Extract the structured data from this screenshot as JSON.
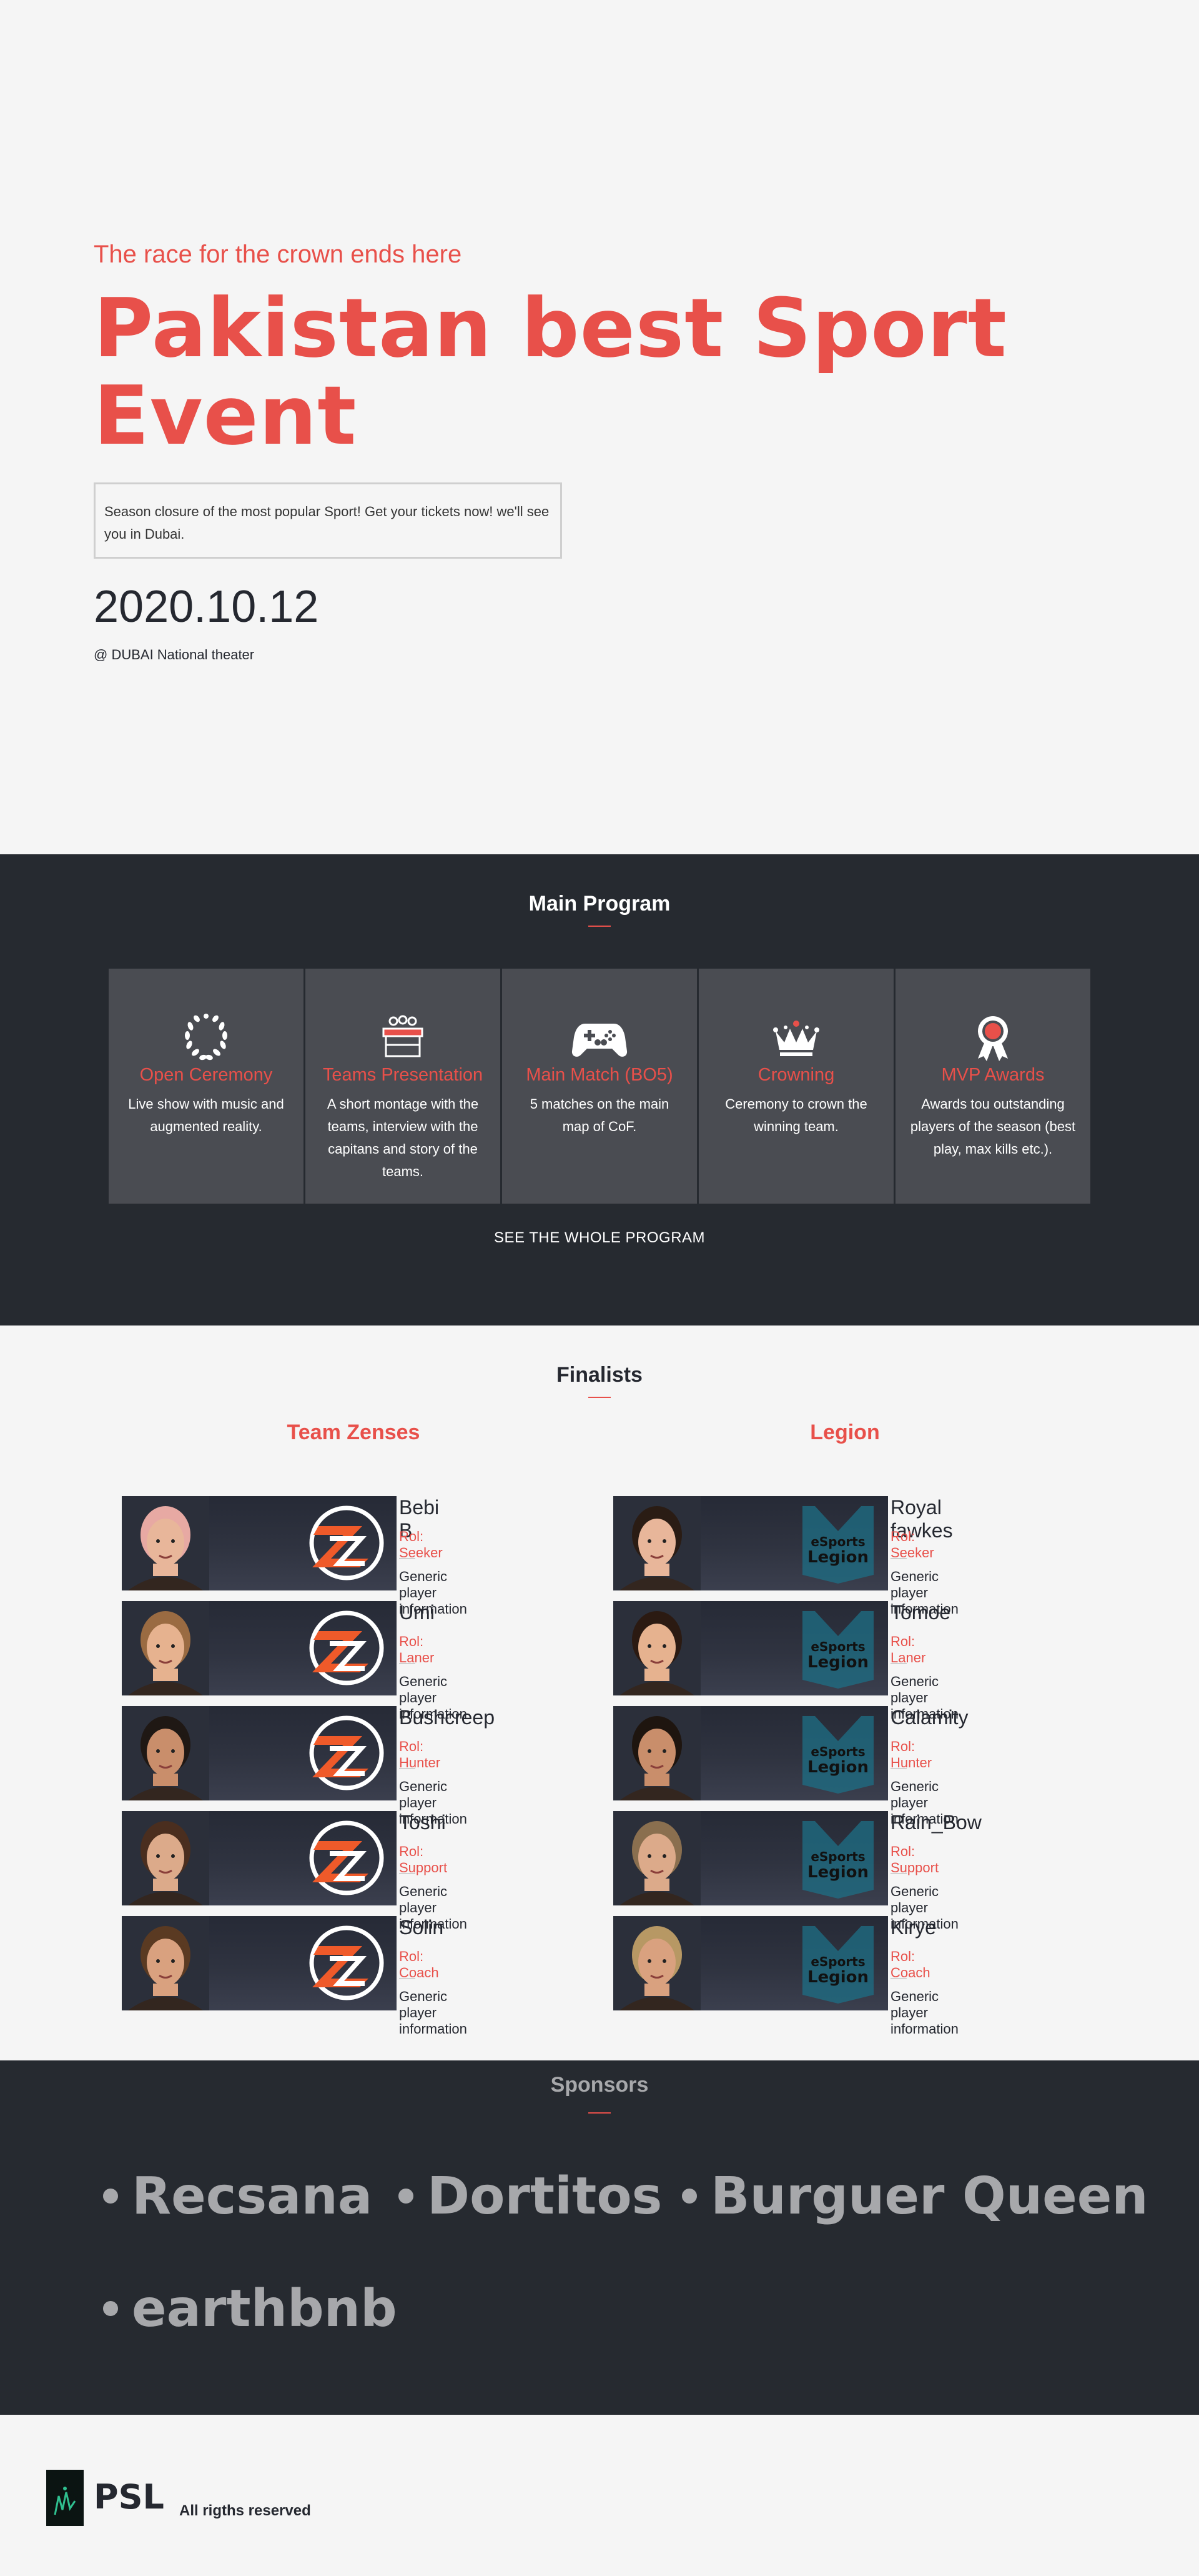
{
  "hero": {
    "tagline": "The race for the crown ends here",
    "title": "Pakistan best Sport Event",
    "description": "Season closure of the most popular Sport! Get your tickets now! we'll see you in Dubai.",
    "date": "2020.10.12",
    "venue": "@ DUBAI National theater"
  },
  "program": {
    "title": "Main Program",
    "cards": [
      {
        "icon": "laurel-wreath-icon",
        "title": "Open Ceremony",
        "desc": "Live show with music and augmented reality."
      },
      {
        "icon": "presentation-table-icon",
        "title": "Teams Presentation",
        "desc": "A short montage with the teams, interview with the capitans and story of the teams."
      },
      {
        "icon": "gamepad-icon",
        "title": "Main Match (BO5)",
        "desc": "5 matches on the main map of CoF."
      },
      {
        "icon": "crown-icon",
        "title": "Crowning",
        "desc": "Ceremony to crown the winning team."
      },
      {
        "icon": "award-ribbon-icon",
        "title": "MVP Awards",
        "desc": "Awards tou outstanding players of the season (best play, max kills etc.)."
      }
    ],
    "see_all": "SEE THE WHOLE PROGRAM"
  },
  "finalists": {
    "title": "Finalists",
    "teams": [
      {
        "name": "Team Zenses",
        "players": [
          {
            "name": "Bebi B",
            "role": "Rol: Seeker",
            "info": "Generic player information"
          },
          {
            "name": "Umi",
            "role": "Rol: Laner",
            "info": "Generic player information"
          },
          {
            "name": "Bushcreep",
            "role": "Rol: Hunter",
            "info": "Generic player information"
          },
          {
            "name": "Toshi",
            "role": "Rol: Support",
            "info": "Generic player information"
          },
          {
            "name": "Solin",
            "role": "Rol: Coach",
            "info": "Generic player information"
          }
        ]
      },
      {
        "name": "Legion",
        "players": [
          {
            "name": "Royal fawkes",
            "role": "Rol: Seeker",
            "info": "Generic player information"
          },
          {
            "name": "Tomoe",
            "role": "Rol: Laner",
            "info": "Generic player information"
          },
          {
            "name": "Calamity",
            "role": "Rol: Hunter",
            "info": "Generic player information"
          },
          {
            "name": "Rain_Bow",
            "role": "Rol: Support",
            "info": "Generic player information"
          },
          {
            "name": "Kirye",
            "role": "Rol: Coach",
            "info": "Generic player information"
          }
        ]
      }
    ],
    "legion_logo_text": [
      "eSports",
      "Legion"
    ]
  },
  "sponsors": {
    "title": "Sponsors",
    "names": [
      "Recsana",
      "Dortitos",
      "Burguer Queen",
      "earthbnb"
    ]
  },
  "footer": {
    "brand": "PSL",
    "rights": "All rigths reserved"
  },
  "colors": {
    "accent": "#e8504a",
    "dark": "#262a30",
    "card": "#4a4c52",
    "light": "#f5f5f5"
  }
}
